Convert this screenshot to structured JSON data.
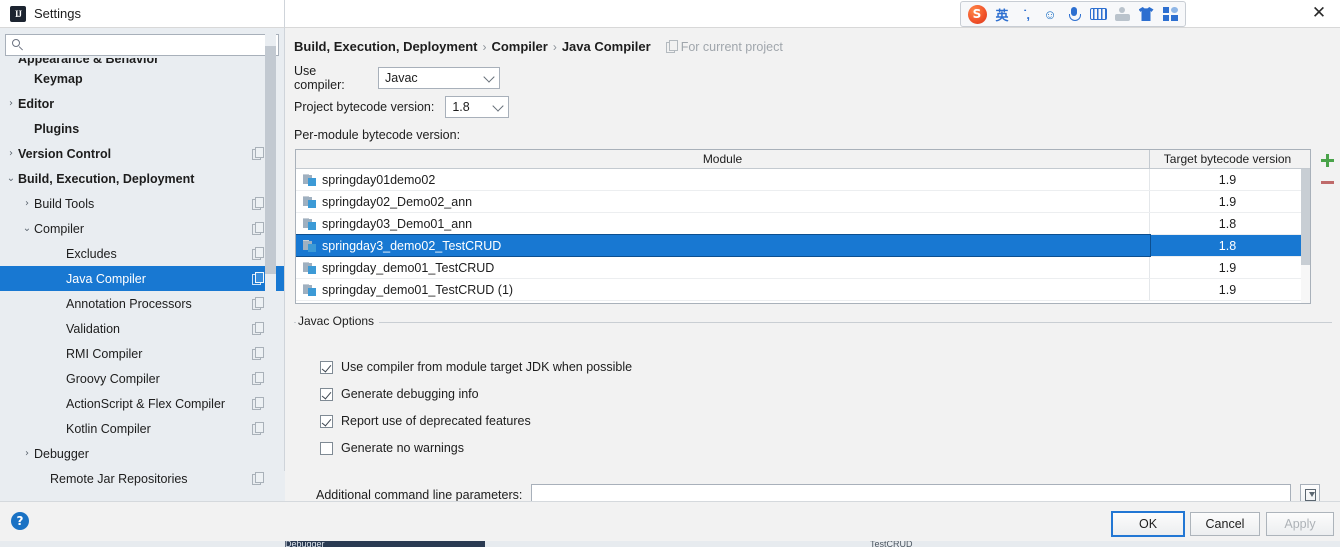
{
  "window": {
    "title": "Settings",
    "app_icon": "intellij-idea-icon",
    "close_label": "✕"
  },
  "ime_toolbar": {
    "items": [
      {
        "name": "sogou-logo-icon",
        "glyph": "S"
      },
      {
        "name": "input-mode-english-icon",
        "glyph": "英"
      },
      {
        "name": "punctuation-icon",
        "glyph": "˙,"
      },
      {
        "name": "emoji-icon",
        "glyph": "☺"
      },
      {
        "name": "voice-input-icon",
        "glyph": "mic"
      },
      {
        "name": "soft-keyboard-icon",
        "glyph": "keyboard"
      },
      {
        "name": "user-account-icon",
        "glyph": "person"
      },
      {
        "name": "skin-icon",
        "glyph": "tshirt"
      },
      {
        "name": "toolbox-icon",
        "glyph": "grid"
      }
    ]
  },
  "sidebar": {
    "search": {
      "placeholder": "",
      "value": ""
    },
    "items": [
      {
        "label": "Appearance & Behavior",
        "indent": 0,
        "arrow": "›",
        "bold": true,
        "selected": false,
        "copy": false,
        "clipped": true
      },
      {
        "label": "Keymap",
        "indent": 1,
        "arrow": "",
        "bold": true,
        "selected": false,
        "copy": false
      },
      {
        "label": "Editor",
        "indent": 0,
        "arrow": "›",
        "bold": true,
        "selected": false,
        "copy": false
      },
      {
        "label": "Plugins",
        "indent": 1,
        "arrow": "",
        "bold": true,
        "selected": false,
        "copy": false
      },
      {
        "label": "Version Control",
        "indent": 0,
        "arrow": "›",
        "bold": true,
        "selected": false,
        "copy": true
      },
      {
        "label": "Build, Execution, Deployment",
        "indent": 0,
        "arrow": "⌄",
        "bold": true,
        "selected": false,
        "copy": false
      },
      {
        "label": "Build Tools",
        "indent": 1,
        "arrow": "›",
        "bold": false,
        "selected": false,
        "copy": true
      },
      {
        "label": "Compiler",
        "indent": 1,
        "arrow": "⌄",
        "bold": false,
        "selected": false,
        "copy": true
      },
      {
        "label": "Excludes",
        "indent": 3,
        "arrow": "",
        "bold": false,
        "selected": false,
        "copy": true
      },
      {
        "label": "Java Compiler",
        "indent": 3,
        "arrow": "",
        "bold": false,
        "selected": true,
        "copy": true
      },
      {
        "label": "Annotation Processors",
        "indent": 3,
        "arrow": "",
        "bold": false,
        "selected": false,
        "copy": true
      },
      {
        "label": "Validation",
        "indent": 3,
        "arrow": "",
        "bold": false,
        "selected": false,
        "copy": true
      },
      {
        "label": "RMI Compiler",
        "indent": 3,
        "arrow": "",
        "bold": false,
        "selected": false,
        "copy": true
      },
      {
        "label": "Groovy Compiler",
        "indent": 3,
        "arrow": "",
        "bold": false,
        "selected": false,
        "copy": true
      },
      {
        "label": "ActionScript & Flex Compiler",
        "indent": 3,
        "arrow": "",
        "bold": false,
        "selected": false,
        "copy": true
      },
      {
        "label": "Kotlin Compiler",
        "indent": 3,
        "arrow": "",
        "bold": false,
        "selected": false,
        "copy": true
      },
      {
        "label": "Debugger",
        "indent": 1,
        "arrow": "›",
        "bold": false,
        "selected": false,
        "copy": false
      },
      {
        "label": "Remote Jar Repositories",
        "indent": 2,
        "arrow": "",
        "bold": false,
        "selected": false,
        "copy": true
      }
    ]
  },
  "main": {
    "breadcrumb": {
      "part1": "Build, Execution, Deployment",
      "sep1": "›",
      "part2": "Compiler",
      "sep2": "›",
      "part3": "Java Compiler",
      "scope_note": "For current project"
    },
    "use_compiler": {
      "label": "Use compiler:",
      "value": "Javac"
    },
    "project_bytecode": {
      "label": "Project bytecode version:",
      "value": "1.8"
    },
    "per_module_label": "Per-module bytecode version:",
    "table": {
      "columns": [
        "Module",
        "Target bytecode version"
      ],
      "rows": [
        {
          "module": "springday01demo02",
          "target": "1.9",
          "selected": false
        },
        {
          "module": "springday02_Demo02_ann",
          "target": "1.9",
          "selected": false
        },
        {
          "module": "springday03_Demo01_ann",
          "target": "1.8",
          "selected": false
        },
        {
          "module": "springday3_demo02_TestCRUD",
          "target": "1.8",
          "selected": true
        },
        {
          "module": "springday_demo01_TestCRUD",
          "target": "1.9",
          "selected": false
        },
        {
          "module": "springday_demo01_TestCRUD (1)",
          "target": "1.9",
          "selected": false
        }
      ]
    },
    "add_button_label": "+",
    "remove_button_label": "−",
    "javac_options": {
      "title": "Javac Options",
      "checkboxes": [
        {
          "label": "Use compiler from module target JDK when possible",
          "checked": true
        },
        {
          "label": "Generate debugging info",
          "checked": true
        },
        {
          "label": "Report use of deprecated features",
          "checked": true
        },
        {
          "label": "Generate no warnings",
          "checked": false
        }
      ],
      "additional_params": {
        "label": "Additional command line parameters:",
        "value": "",
        "placeholder": ""
      }
    }
  },
  "footer": {
    "help_label": "?",
    "ok_label": "OK",
    "cancel_label": "Cancel",
    "apply_label": "Apply"
  },
  "background_window": {
    "left_text": "Debugger",
    "right_text": "TestCRUD"
  },
  "colors": {
    "selection_blue": "#1878d2",
    "accent_blue": "#1a72c4",
    "panel_bg": "#f2f2f2",
    "sidebar_bg": "#e9edf1",
    "add_green": "#4aa34a",
    "remove_red": "#bf6a6a"
  }
}
